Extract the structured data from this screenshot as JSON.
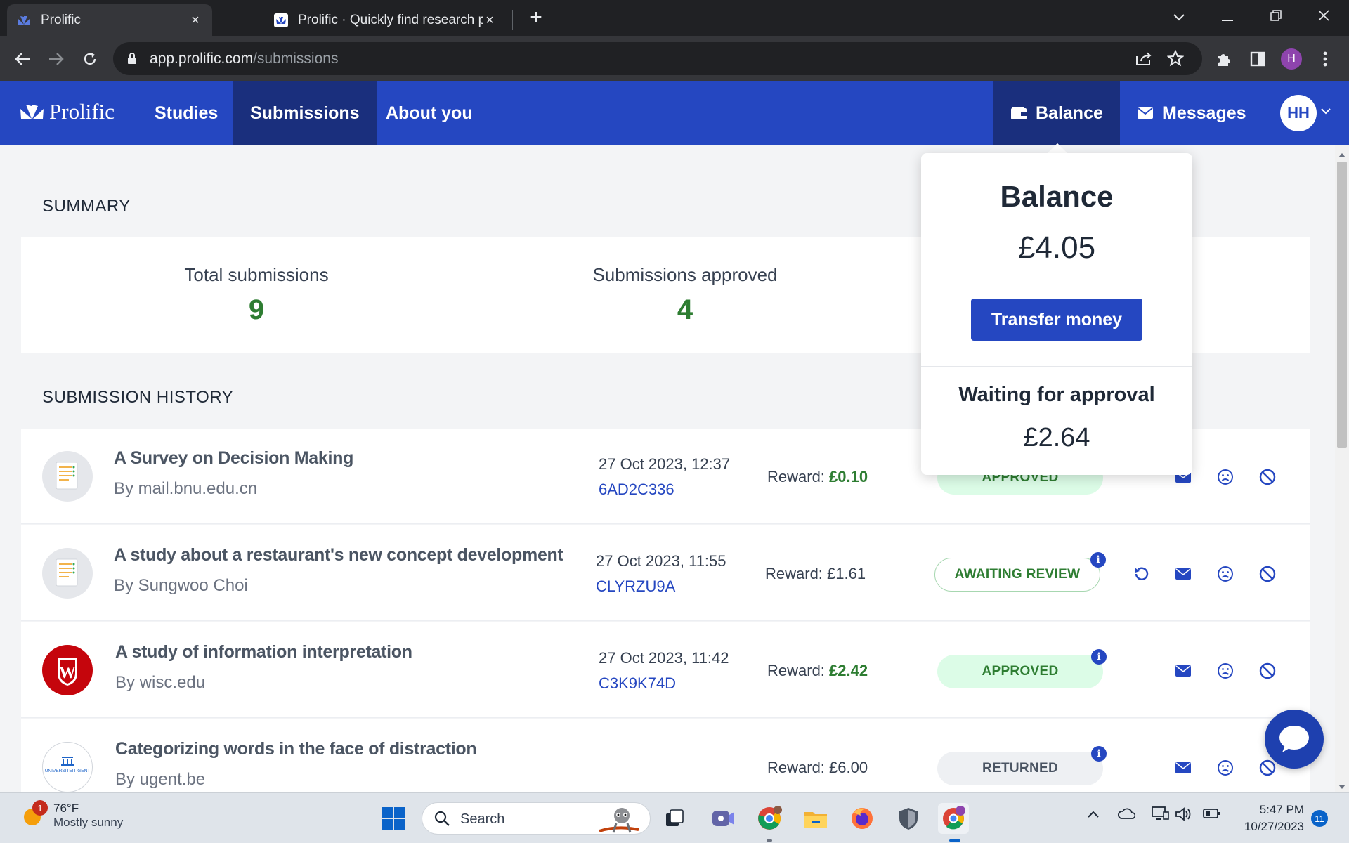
{
  "browser": {
    "tabs": [
      {
        "title": "Prolific",
        "active": true
      },
      {
        "title": "Prolific · Quickly find research pa",
        "active": false
      }
    ],
    "url_host": "app.prolific.com",
    "url_path": "/submissions",
    "profile_initial": "H"
  },
  "nav": {
    "logo": "Prolific",
    "links": [
      "Studies",
      "Submissions",
      "About you"
    ],
    "active_link": "Submissions",
    "balance_label": "Balance",
    "messages_label": "Messages",
    "avatar": "HH",
    "brand_color": "#2547c1"
  },
  "summary": {
    "title": "SUMMARY",
    "total_label": "Total submissions",
    "total_value": "9",
    "approved_label": "Submissions approved",
    "approved_value": "4"
  },
  "history": {
    "title": "SUBMISSION HISTORY",
    "reward_prefix": "Reward: ",
    "rows": [
      {
        "name": "A Survey on Decision Making",
        "by": "By mail.bnu.edu.cn",
        "date": "27 Oct 2023, 12:37",
        "code": "6AD2C336",
        "reward": "£0.10",
        "reward_highlight": true,
        "status": "APPROVED",
        "icon": "document-icon"
      },
      {
        "name": "A study about a restaurant's new concept development",
        "by": "By Sungwoo Choi",
        "date": "27 Oct 2023, 11:55",
        "code": "CLYRZU9A",
        "reward": "£1.61",
        "reward_highlight": false,
        "status": "AWAITING REVIEW",
        "icon": "document-icon"
      },
      {
        "name": "A study of information interpretation",
        "by": "By wisc.edu",
        "date": "27 Oct 2023, 11:42",
        "code": "C3K9K74D",
        "reward": "£2.42",
        "reward_highlight": true,
        "status": "APPROVED",
        "icon": "wisc-logo"
      },
      {
        "name": "Categorizing words in the face of distraction",
        "by": "By ugent.be",
        "date": "",
        "code": "",
        "reward": "£6.00",
        "reward_highlight": false,
        "status": "RETURNED",
        "icon": "ugent-logo"
      }
    ]
  },
  "balance_popover": {
    "title": "Balance",
    "amount": "£4.05",
    "transfer_label": "Transfer money",
    "waiting_label": "Waiting for approval",
    "waiting_amount": "£2.64"
  },
  "taskbar": {
    "temp": "76°F",
    "weather": "Mostly sunny",
    "weather_badge": "1",
    "search_label": "Search",
    "time": "5:47 PM",
    "date": "10/27/2023",
    "notifications": "11"
  },
  "ugent_text": "UNIVERSITEIT GENT"
}
